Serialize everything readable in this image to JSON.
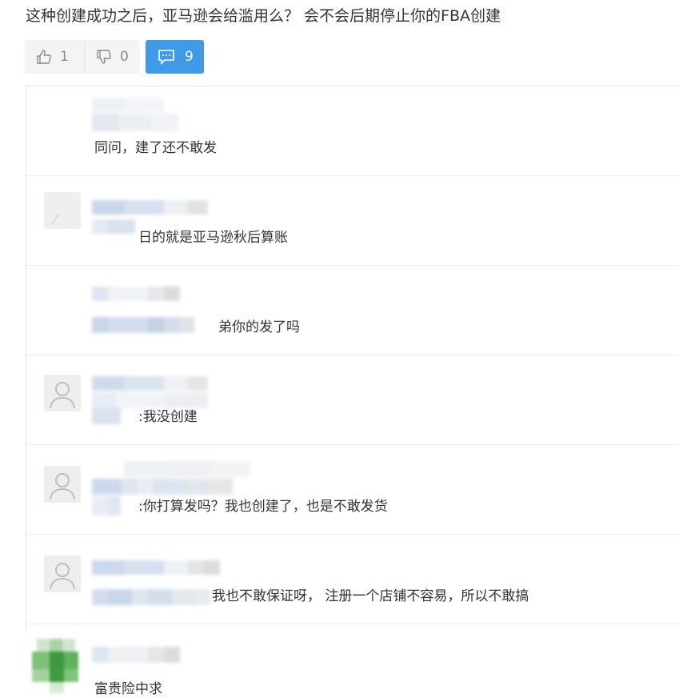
{
  "question": {
    "text": "这种创建成功之后，亚马逊会给滥用么？  会不会后期停止你的FBA创建"
  },
  "actions": {
    "like_count": "1",
    "dislike_count": "0",
    "comment_count": "9",
    "like_icon": "thumbs-up-icon",
    "dislike_icon": "thumbs-down-icon",
    "comment_icon": "comment-bubble-icon",
    "comment_button_color": "#3f9ae8"
  },
  "comments": [
    {
      "text": "同问，建了还不敢发"
    },
    {
      "text": "日的就是亚马逊秋后算账"
    },
    {
      "text": "弟你的发了吗"
    },
    {
      "text": ":我没创建"
    },
    {
      "text": ":你打算发吗？我也创建了，也是不敢发货"
    },
    {
      "text": "我也不敢保证呀， 注册一个店铺不容易，所以不敢搞"
    },
    {
      "text": "富贵险中求"
    }
  ]
}
